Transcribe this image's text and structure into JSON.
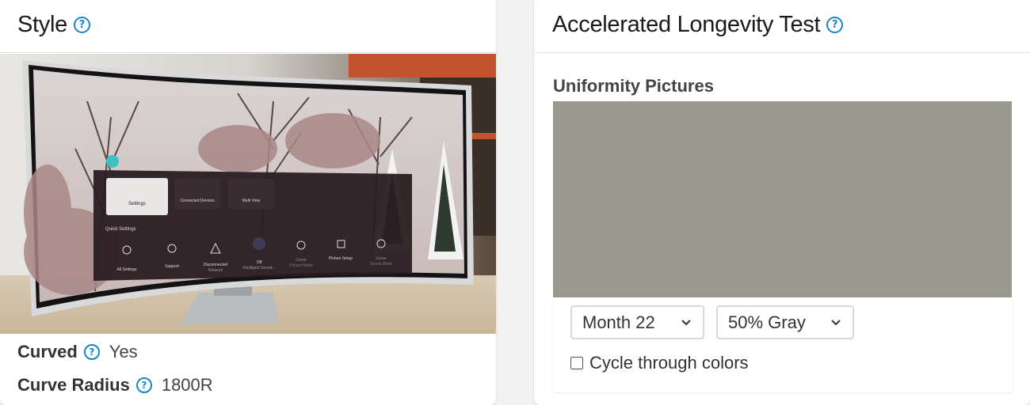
{
  "style_card": {
    "title": "Style",
    "help_icon": "question-circle-icon",
    "tv_image": {
      "subject": "curved-tv-photo",
      "menu": {
        "tiles": [
          "Settings",
          "Connected Devices",
          "Multi View"
        ],
        "quick_settings_label": "Quick Settings",
        "quick_items": [
          {
            "label": "All Settings",
            "sub": ""
          },
          {
            "label": "Support",
            "sub": ""
          },
          {
            "label": "Disconnected",
            "sub": "Network"
          },
          {
            "label": "Off",
            "sub": "Intelligent Sound..."
          },
          {
            "label": "Game",
            "sub": "Picture Mode"
          },
          {
            "label": "Picture Setup",
            "sub": ""
          },
          {
            "label": "Game",
            "sub": "Sound Mode"
          }
        ]
      }
    },
    "specs": [
      {
        "label": "Curved",
        "value": "Yes"
      },
      {
        "label": "Curve Radius",
        "value": "1800R"
      }
    ]
  },
  "alt_card": {
    "title": "Accelerated Longevity Test",
    "section_label": "Uniformity Pictures",
    "uniformity_color": "#999990",
    "month_select": "Month 22",
    "color_select": "50% Gray",
    "checkbox_label": "Cycle through colors",
    "checkbox_checked": false
  }
}
